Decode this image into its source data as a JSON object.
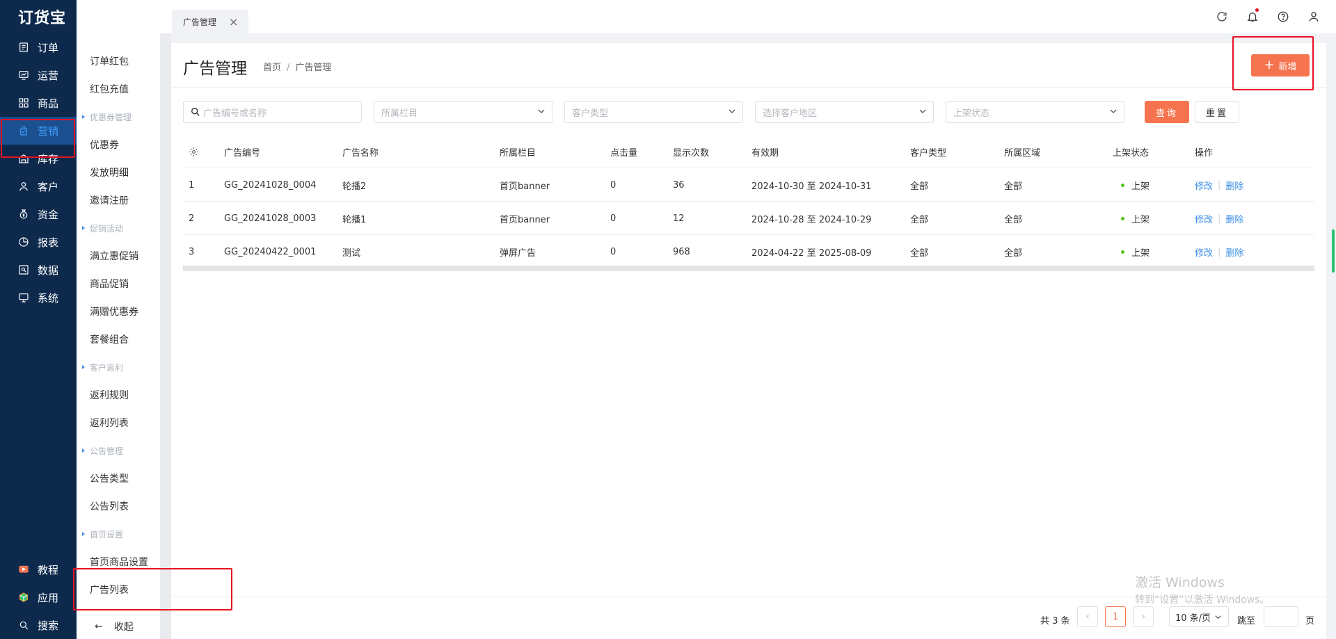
{
  "app": {
    "logo": "订货宝"
  },
  "nav": {
    "items": [
      {
        "label": "订单",
        "icon": "order-icon"
      },
      {
        "label": "运营",
        "icon": "operation-icon"
      },
      {
        "label": "商品",
        "icon": "goods-icon"
      },
      {
        "label": "营销",
        "icon": "marketing-icon"
      },
      {
        "label": "库存",
        "icon": "warehouse-icon"
      },
      {
        "label": "客户",
        "icon": "customer-icon"
      },
      {
        "label": "资金",
        "icon": "money-icon"
      },
      {
        "label": "报表",
        "icon": "report-icon"
      },
      {
        "label": "数据",
        "icon": "data-icon"
      },
      {
        "label": "系统",
        "icon": "system-icon"
      }
    ],
    "bottom": [
      {
        "label": "教程",
        "icon": "tutorial-icon"
      },
      {
        "label": "应用",
        "icon": "apps-icon"
      },
      {
        "label": "搜索",
        "icon": "search-icon"
      }
    ],
    "active_color": "#3fa0ff"
  },
  "submenu": {
    "entries": [
      {
        "type": "item",
        "label": "订单红包"
      },
      {
        "type": "item",
        "label": "红包充值"
      },
      {
        "type": "group",
        "label": "优惠券管理"
      },
      {
        "type": "item",
        "label": "优惠券"
      },
      {
        "type": "item",
        "label": "发放明细"
      },
      {
        "type": "item",
        "label": "邀请注册"
      },
      {
        "type": "group",
        "label": "促销活动"
      },
      {
        "type": "item",
        "label": "满立惠促销"
      },
      {
        "type": "item",
        "label": "商品促销"
      },
      {
        "type": "item",
        "label": "满赠优惠券"
      },
      {
        "type": "item",
        "label": "套餐组合"
      },
      {
        "type": "group",
        "label": "客户返利"
      },
      {
        "type": "item",
        "label": "返利规则"
      },
      {
        "type": "item",
        "label": "返利列表"
      },
      {
        "type": "group",
        "label": "公告管理"
      },
      {
        "type": "item",
        "label": "公告类型"
      },
      {
        "type": "item",
        "label": "公告列表"
      },
      {
        "type": "group",
        "label": "首页设置"
      },
      {
        "type": "item",
        "label": "首页商品设置"
      },
      {
        "type": "item",
        "label": "广告列表"
      }
    ],
    "collapse_label": "收起"
  },
  "tabs": [
    {
      "label": "广告管理"
    }
  ],
  "page": {
    "title": "广告管理",
    "breadcrumb": [
      "首页",
      "广告管理"
    ],
    "add_label": "新增"
  },
  "filters": {
    "search_placeholder": "广告编号或名称",
    "column_placeholder": "所属栏目",
    "customer_type_placeholder": "客户类型",
    "region_placeholder": "选择客户地区",
    "status_placeholder": "上架状态",
    "query_label": "查询",
    "reset_label": "重置"
  },
  "table": {
    "headers": [
      "广告编号",
      "广告名称",
      "所属栏目",
      "点击量",
      "显示次数",
      "有效期",
      "客户类型",
      "所属区域",
      "上架状态",
      "操作"
    ],
    "rows": [
      {
        "idx": "1",
        "code": "GG_20241028_0004",
        "name": "轮播2",
        "column": "首页banner",
        "clicks": "0",
        "views": "36",
        "period": "2024-10-30 至 2024-10-31",
        "ctype": "全部",
        "region": "全部",
        "status": "上架",
        "edit": "修改",
        "del": "删除"
      },
      {
        "idx": "2",
        "code": "GG_20241028_0003",
        "name": "轮播1",
        "column": "首页banner",
        "clicks": "0",
        "views": "12",
        "period": "2024-10-28 至 2024-10-29",
        "ctype": "全部",
        "region": "全部",
        "status": "上架",
        "edit": "修改",
        "del": "删除"
      },
      {
        "idx": "3",
        "code": "GG_20240422_0001",
        "name": "测试",
        "column": "弹屏广告",
        "clicks": "0",
        "views": "968",
        "period": "2024-04-22 至 2025-08-09",
        "ctype": "全部",
        "region": "全部",
        "status": "上架",
        "edit": "修改",
        "del": "删除"
      }
    ]
  },
  "pagination": {
    "total": "共 3 条",
    "current": "1",
    "page_size": "10 条/页",
    "goto": "跳至",
    "page_unit": "页"
  },
  "watermark": {
    "line1": "激活 Windows",
    "line2": "转到“设置”以激活 Windows。"
  },
  "colors": {
    "accent": "#f5744f",
    "nav_bg": "#0d2a4d",
    "link": "#3a8ee6",
    "status_on": "#52c41a"
  }
}
